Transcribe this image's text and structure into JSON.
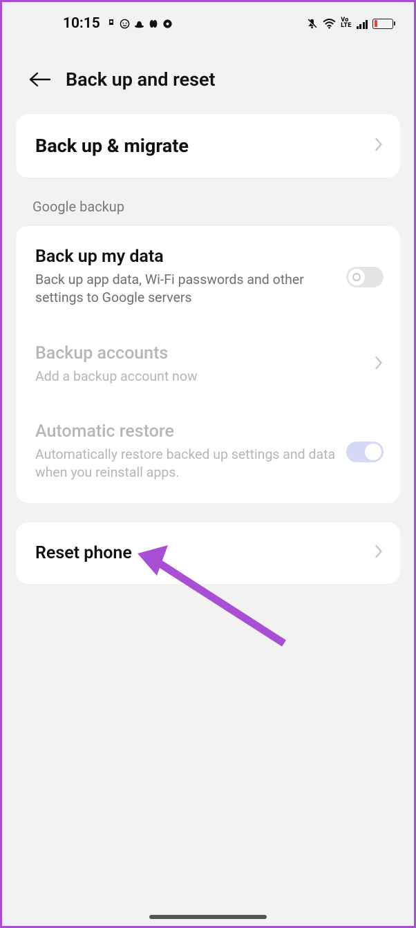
{
  "status": {
    "time": "10:15",
    "left_icons": [
      "download-icon",
      "emoji-icon",
      "cloud-icon",
      "pill-icon",
      "donut-icon"
    ],
    "right": {
      "mute": true,
      "wifi": true,
      "volte": "VoLTE",
      "signal": 4,
      "battery_low": true
    }
  },
  "header": {
    "title": "Back up and reset"
  },
  "cards": {
    "backup_migrate": {
      "title": "Back up & migrate"
    },
    "section_label": "Google backup",
    "google_backup": {
      "backup_my_data": {
        "title": "Back up my data",
        "sub": "Back up app data, Wi-Fi passwords and other settings to Google servers",
        "enabled": false
      },
      "backup_accounts": {
        "title": "Backup accounts",
        "sub": "Add a backup account now"
      },
      "automatic_restore": {
        "title": "Automatic restore",
        "sub": "Automatically restore backed up settings and data when you reinstall apps.",
        "enabled": true
      }
    },
    "reset_phone": {
      "title": "Reset phone"
    }
  },
  "annotation": {
    "arrow_color": "#a84fd4"
  }
}
